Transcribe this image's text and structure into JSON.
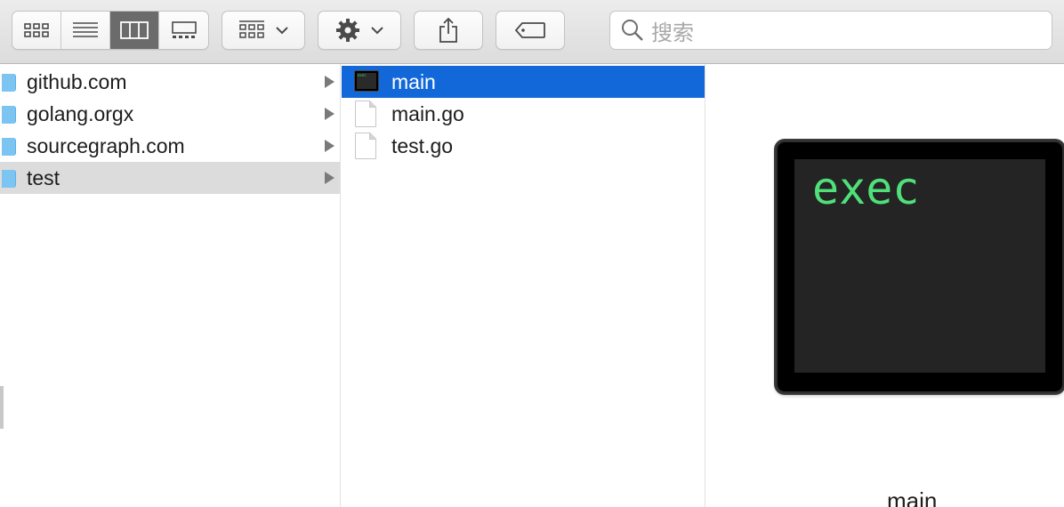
{
  "toolbar": {
    "view_modes": [
      "icon-view",
      "list-view",
      "column-view",
      "gallery-view"
    ],
    "active_view": "column-view",
    "search_placeholder": "搜索"
  },
  "sidebar_column": {
    "items": [
      {
        "label": "github.com"
      },
      {
        "label": "golang.orgx"
      },
      {
        "label": "sourcegraph.com"
      },
      {
        "label": "test"
      }
    ]
  },
  "file_column": {
    "items": [
      {
        "label": "main",
        "type": "executable"
      },
      {
        "label": "main.go",
        "type": "document"
      },
      {
        "label": "test.go",
        "type": "document"
      }
    ]
  },
  "preview": {
    "icon_text": "exec",
    "file_name": "main"
  },
  "colors": {
    "selection_blue": "#1368d9",
    "selection_gray": "#dcdcdc",
    "folder": "#7cc4f2",
    "exec_text": "#4fe07a"
  }
}
